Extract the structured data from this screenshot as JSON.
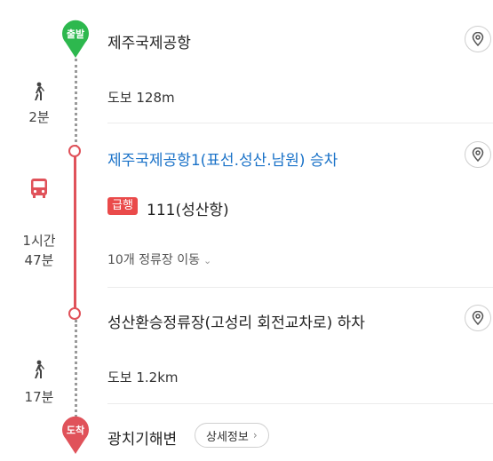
{
  "colors": {
    "start_pin": "#2db84e",
    "end_pin": "#e0525a",
    "bus_line": "#e0525a",
    "link_blue": "#1a72c8",
    "express_badge": "#ea4a4a"
  },
  "start": {
    "pin_label": "출발",
    "name": "제주국제공항",
    "icon": "location-pin-icon"
  },
  "walk1": {
    "icon": "walking-person-icon",
    "duration": "2분",
    "text": "도보 128m"
  },
  "bus": {
    "board_stop": "제주국제공항1(표선.성산.남원) 승차",
    "icon": "bus-icon",
    "duration_line1": "1시간",
    "duration_line2": "47분",
    "badge": "급행",
    "route": "111(성산항)",
    "stops_text": "10개 정류장 이동",
    "alight_stop": "성산환승정류장(고성리 회전교차로) 하차"
  },
  "walk2": {
    "icon": "walking-person-icon",
    "duration": "17분",
    "text": "도보 1.2km"
  },
  "end": {
    "pin_label": "도착",
    "name": "광치기해변",
    "detail_button": "상세정보"
  }
}
